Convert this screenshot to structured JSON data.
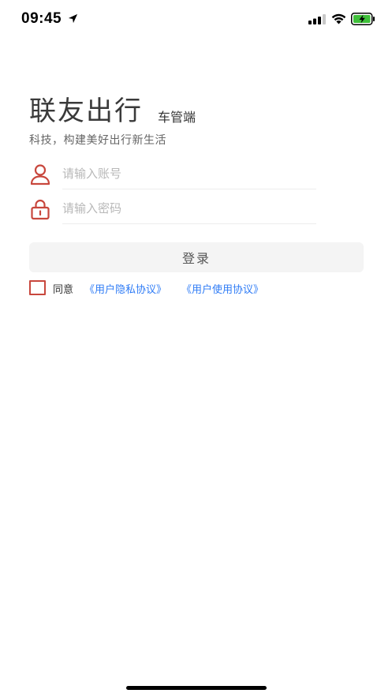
{
  "status_bar": {
    "time": "09:45",
    "icons": [
      "location-arrow-icon",
      "signal-icon",
      "wifi-icon",
      "battery-charging-icon"
    ]
  },
  "brand": {
    "title": "联友出行",
    "subtitle": "车管端",
    "slogan": "科技，构建美好出行新生活"
  },
  "form": {
    "username_placeholder": "请输入账号",
    "password_placeholder": "请输入密码",
    "login_label": "登录"
  },
  "agreement": {
    "prefix": "同意",
    "privacy_link": "《用户隐私协议》",
    "user_link": "《用户使用协议》",
    "checked": false
  },
  "colors": {
    "accent_red": "#c8473d",
    "link_blue": "#2f7cf6",
    "button_bg": "#f4f4f4",
    "battery_green": "#3fbf3a"
  }
}
